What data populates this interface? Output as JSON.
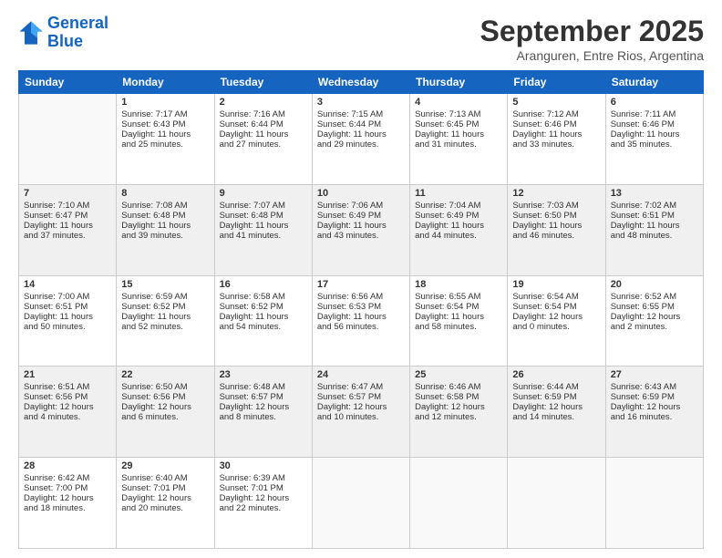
{
  "logo": {
    "line1": "General",
    "line2": "Blue"
  },
  "title": "September 2025",
  "subtitle": "Aranguren, Entre Rios, Argentina",
  "days": [
    "Sunday",
    "Monday",
    "Tuesday",
    "Wednesday",
    "Thursday",
    "Friday",
    "Saturday"
  ],
  "weeks": [
    [
      {
        "day": "",
        "content": ""
      },
      {
        "day": "1",
        "content": "Sunrise: 7:17 AM\nSunset: 6:43 PM\nDaylight: 11 hours\nand 25 minutes."
      },
      {
        "day": "2",
        "content": "Sunrise: 7:16 AM\nSunset: 6:44 PM\nDaylight: 11 hours\nand 27 minutes."
      },
      {
        "day": "3",
        "content": "Sunrise: 7:15 AM\nSunset: 6:44 PM\nDaylight: 11 hours\nand 29 minutes."
      },
      {
        "day": "4",
        "content": "Sunrise: 7:13 AM\nSunset: 6:45 PM\nDaylight: 11 hours\nand 31 minutes."
      },
      {
        "day": "5",
        "content": "Sunrise: 7:12 AM\nSunset: 6:46 PM\nDaylight: 11 hours\nand 33 minutes."
      },
      {
        "day": "6",
        "content": "Sunrise: 7:11 AM\nSunset: 6:46 PM\nDaylight: 11 hours\nand 35 minutes."
      }
    ],
    [
      {
        "day": "7",
        "content": "Sunrise: 7:10 AM\nSunset: 6:47 PM\nDaylight: 11 hours\nand 37 minutes."
      },
      {
        "day": "8",
        "content": "Sunrise: 7:08 AM\nSunset: 6:48 PM\nDaylight: 11 hours\nand 39 minutes."
      },
      {
        "day": "9",
        "content": "Sunrise: 7:07 AM\nSunset: 6:48 PM\nDaylight: 11 hours\nand 41 minutes."
      },
      {
        "day": "10",
        "content": "Sunrise: 7:06 AM\nSunset: 6:49 PM\nDaylight: 11 hours\nand 43 minutes."
      },
      {
        "day": "11",
        "content": "Sunrise: 7:04 AM\nSunset: 6:49 PM\nDaylight: 11 hours\nand 44 minutes."
      },
      {
        "day": "12",
        "content": "Sunrise: 7:03 AM\nSunset: 6:50 PM\nDaylight: 11 hours\nand 46 minutes."
      },
      {
        "day": "13",
        "content": "Sunrise: 7:02 AM\nSunset: 6:51 PM\nDaylight: 11 hours\nand 48 minutes."
      }
    ],
    [
      {
        "day": "14",
        "content": "Sunrise: 7:00 AM\nSunset: 6:51 PM\nDaylight: 11 hours\nand 50 minutes."
      },
      {
        "day": "15",
        "content": "Sunrise: 6:59 AM\nSunset: 6:52 PM\nDaylight: 11 hours\nand 52 minutes."
      },
      {
        "day": "16",
        "content": "Sunrise: 6:58 AM\nSunset: 6:52 PM\nDaylight: 11 hours\nand 54 minutes."
      },
      {
        "day": "17",
        "content": "Sunrise: 6:56 AM\nSunset: 6:53 PM\nDaylight: 11 hours\nand 56 minutes."
      },
      {
        "day": "18",
        "content": "Sunrise: 6:55 AM\nSunset: 6:54 PM\nDaylight: 11 hours\nand 58 minutes."
      },
      {
        "day": "19",
        "content": "Sunrise: 6:54 AM\nSunset: 6:54 PM\nDaylight: 12 hours\nand 0 minutes."
      },
      {
        "day": "20",
        "content": "Sunrise: 6:52 AM\nSunset: 6:55 PM\nDaylight: 12 hours\nand 2 minutes."
      }
    ],
    [
      {
        "day": "21",
        "content": "Sunrise: 6:51 AM\nSunset: 6:56 PM\nDaylight: 12 hours\nand 4 minutes."
      },
      {
        "day": "22",
        "content": "Sunrise: 6:50 AM\nSunset: 6:56 PM\nDaylight: 12 hours\nand 6 minutes."
      },
      {
        "day": "23",
        "content": "Sunrise: 6:48 AM\nSunset: 6:57 PM\nDaylight: 12 hours\nand 8 minutes."
      },
      {
        "day": "24",
        "content": "Sunrise: 6:47 AM\nSunset: 6:57 PM\nDaylight: 12 hours\nand 10 minutes."
      },
      {
        "day": "25",
        "content": "Sunrise: 6:46 AM\nSunset: 6:58 PM\nDaylight: 12 hours\nand 12 minutes."
      },
      {
        "day": "26",
        "content": "Sunrise: 6:44 AM\nSunset: 6:59 PM\nDaylight: 12 hours\nand 14 minutes."
      },
      {
        "day": "27",
        "content": "Sunrise: 6:43 AM\nSunset: 6:59 PM\nDaylight: 12 hours\nand 16 minutes."
      }
    ],
    [
      {
        "day": "28",
        "content": "Sunrise: 6:42 AM\nSunset: 7:00 PM\nDaylight: 12 hours\nand 18 minutes."
      },
      {
        "day": "29",
        "content": "Sunrise: 6:40 AM\nSunset: 7:01 PM\nDaylight: 12 hours\nand 20 minutes."
      },
      {
        "day": "30",
        "content": "Sunrise: 6:39 AM\nSunset: 7:01 PM\nDaylight: 12 hours\nand 22 minutes."
      },
      {
        "day": "",
        "content": ""
      },
      {
        "day": "",
        "content": ""
      },
      {
        "day": "",
        "content": ""
      },
      {
        "day": "",
        "content": ""
      }
    ]
  ]
}
